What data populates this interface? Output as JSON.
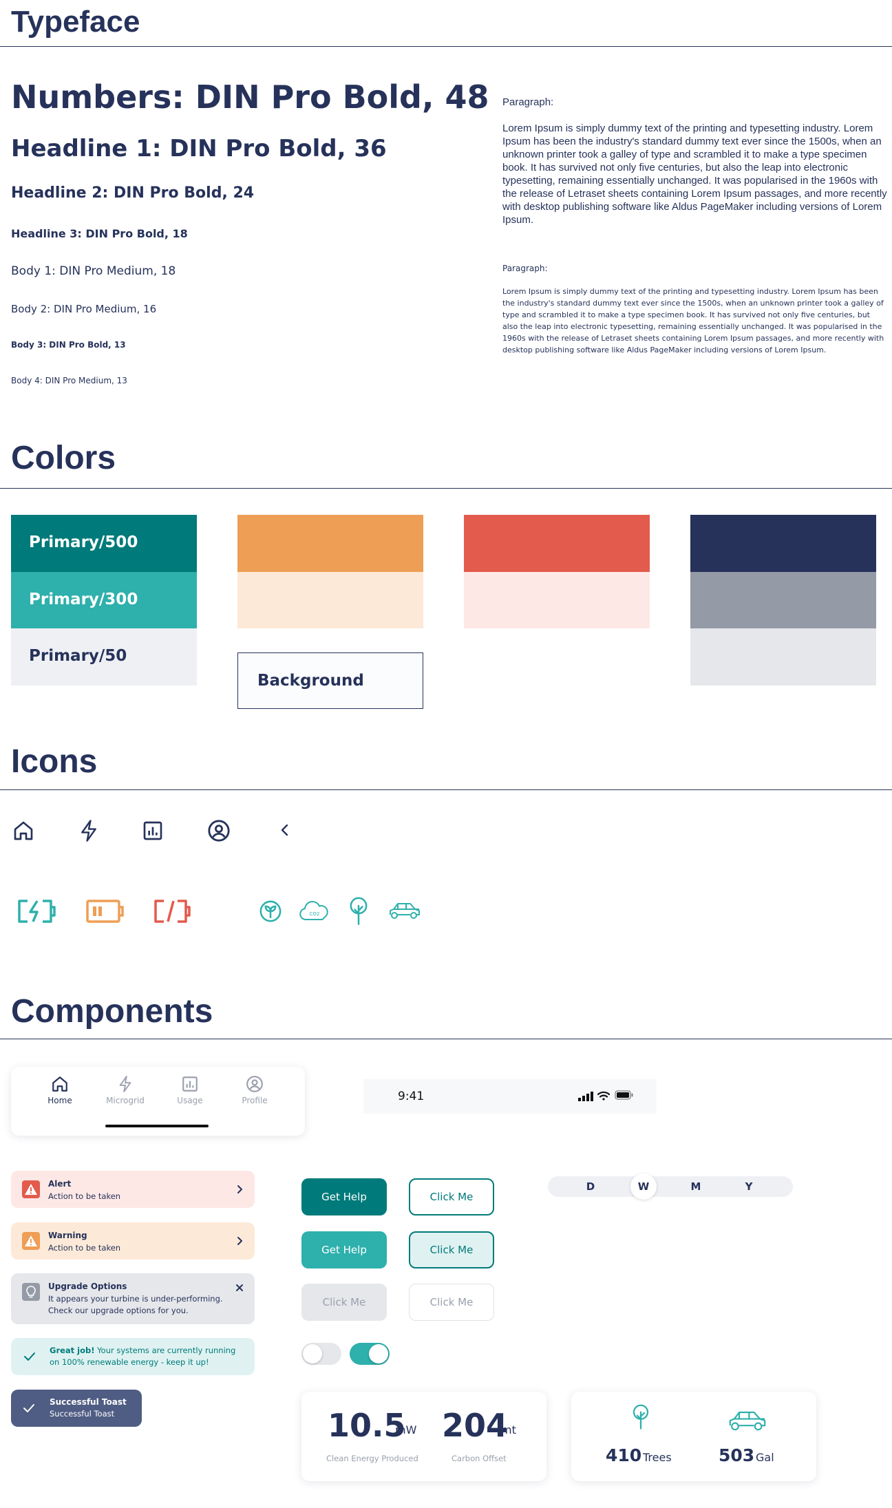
{
  "sections": {
    "typeface": "Typeface",
    "colors": "Colors",
    "icons": "Icons",
    "components": "Components"
  },
  "typeface": {
    "numbers": "Numbers: DIN Pro Bold, 48",
    "h1": "Headline 1: DIN Pro Bold, 36",
    "h2": "Headline 2: DIN Pro Bold, 24",
    "h3": "Headline 3: DIN Pro Bold, 18",
    "body1": "Body 1: DIN Pro Medium, 18",
    "body2": "Body 2: DIN Pro Medium, 16",
    "body3": "Body 3: DIN Pro Bold, 13",
    "body4": "Body 4: DIN Pro Medium, 13",
    "para_label_1": "Paragraph:",
    "para_text_1": "Lorem Ipsum is simply dummy text of the printing and typesetting industry. Lorem Ipsum has been the industry's standard dummy text ever since the 1500s, when an unknown printer took a galley of type and scrambled it to make a type specimen book. It has survived not only five centuries, but also the leap into electronic typesetting, remaining essentially unchanged. It was popularised in the 1960s with the release of Letraset sheets containing Lorem Ipsum passages, and more recently with desktop publishing software like Aldus PageMaker including versions of Lorem Ipsum.",
    "para_label_2": "Paragraph:",
    "para_text_2": "Lorem Ipsum is simply dummy text of the printing and typesetting industry. Lorem Ipsum has been the industry's standard dummy text ever since the 1500s, when an unknown printer took a galley of type and scrambled it to make a type specimen book. It has survived not only five centuries, but also the leap into electronic typesetting, remaining essentially unchanged. It was popularised in the 1960s with the release of Letraset sheets containing Lorem Ipsum passages, and more recently with desktop publishing software like Aldus PageMaker including versions of Lorem Ipsum."
  },
  "colors": {
    "primary500": {
      "label": "Primary/500",
      "hex": "#007a7a"
    },
    "primary300": {
      "label": "Primary/300",
      "hex": "#2eb0ac"
    },
    "primary50": {
      "label": "Primary/50",
      "hex": "#eef0f4"
    },
    "orange": "#ee9e55",
    "orange_light": "#fde9d8",
    "red": "#e25b4c",
    "red_light": "#fde8e6",
    "navy": "#26325a",
    "gray": "#949aa6",
    "gray_light": "#e6e7eb",
    "background": {
      "label": "Background",
      "hex": "#fbfcfe"
    }
  },
  "icons": {
    "row1": [
      "home-icon",
      "lightning-icon",
      "chart-icon",
      "user-circle-icon",
      "chevron-left-icon"
    ],
    "row2": [
      "battery-charging-icon",
      "battery-medium-icon",
      "battery-empty-icon",
      "leaf-icon",
      "co2-cloud-icon",
      "tree-icon",
      "car-icon"
    ],
    "co2_label": "CO2"
  },
  "nav": {
    "items": [
      {
        "label": "Home",
        "icon": "home-icon"
      },
      {
        "label": "Microgrid",
        "icon": "lightning-icon"
      },
      {
        "label": "Usage",
        "icon": "chart-icon"
      },
      {
        "label": "Profile",
        "icon": "user-circle-icon"
      }
    ]
  },
  "status_bar": {
    "time": "9:41"
  },
  "alerts": {
    "alert": {
      "title": "Alert",
      "body": "Action to be taken"
    },
    "warning": {
      "title": "Warning",
      "body": "Action to be taken"
    },
    "upgrade": {
      "title": "Upgrade Options",
      "body_line1": "It appears your turbine is under-performing.",
      "body_line2": "Check our upgrade options for you."
    },
    "success": {
      "bold": "Great job!",
      "line1": " Your systems are currently running",
      "line2": "on  100% renewable energy - keep it up!"
    },
    "toast": {
      "title": "Successful Toast",
      "body": "Successful Toast"
    }
  },
  "buttons": {
    "get_help_1": "Get Help",
    "click_me_1": "Click Me",
    "get_help_2": "Get Help",
    "click_me_2": "Click Me",
    "click_me_disabled": "Click Me",
    "click_me_outline_disabled": "Click Me"
  },
  "segmented": {
    "options": [
      "D",
      "W",
      "M",
      "Y"
    ],
    "selected": "W"
  },
  "toggles": {
    "off": false,
    "on": true
  },
  "stats": {
    "energy": {
      "value": "10.5",
      "unit": "mW",
      "caption": "Clean Energy Produced"
    },
    "carbon": {
      "value": "204",
      "unit": "mt",
      "caption": "Carbon Offset"
    },
    "trees": {
      "value": "410",
      "unit": "Trees"
    },
    "gallons": {
      "value": "503",
      "unit": "Gal"
    }
  }
}
